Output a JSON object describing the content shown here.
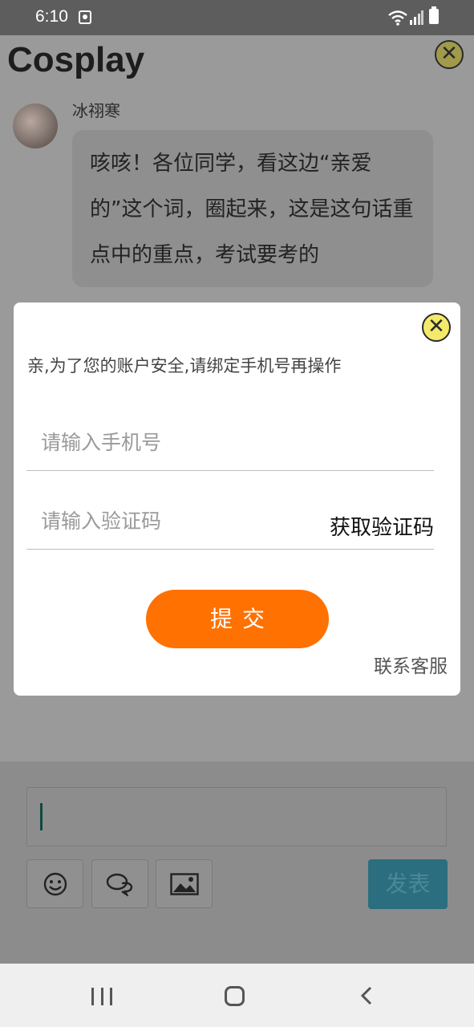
{
  "status_bar": {
    "time": "6:10"
  },
  "page": {
    "title": "Cosplay",
    "post": {
      "author": "冰祤寒",
      "message": "咳咳！各位同学，看这边“亲爱的”这个词，圈起来，这是这句话重点中的重点，考试要考的"
    },
    "bottom": {
      "post_button": "发表"
    }
  },
  "modal": {
    "notice": "亲,为了您的账户安全,请绑定手机号再操作",
    "phone_placeholder": "请输入手机号",
    "code_placeholder": "请输入验证码",
    "get_code_label": "获取验证码",
    "submit_label": "提交",
    "support_label": "联系客服"
  },
  "colors": {
    "accent": "#ff7100",
    "close_yellow": "#f4ea6a",
    "post_button": "#2b6e80"
  },
  "icons": [
    "close-icon",
    "emoji-icon",
    "chat-icon",
    "image-icon",
    "wifi-icon",
    "signal-icon",
    "battery-icon",
    "recent-apps-icon",
    "home-icon",
    "back-icon"
  ]
}
